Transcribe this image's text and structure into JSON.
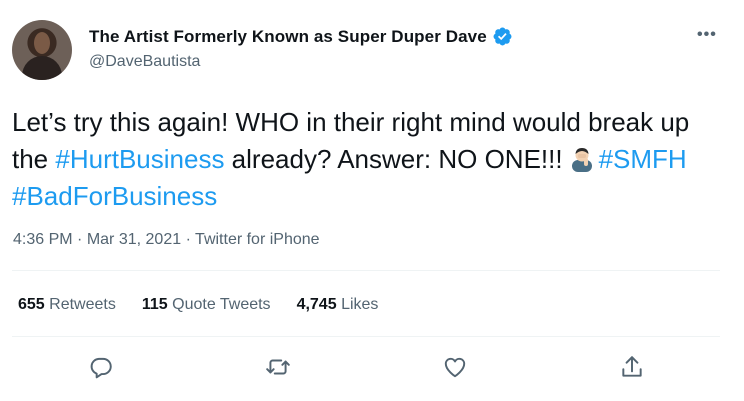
{
  "author": {
    "display_name": "The Artist Formerly Known as Super Duper Dave",
    "handle": "@DaveBautista"
  },
  "tweet": {
    "text_1": "Let’s try this again! WHO in their right mind would break up the ",
    "hashtag_1": "#HurtBusiness",
    "text_2": "  already? Answer: NO ONE!!!",
    "hashtag_2": "#SMFH",
    "hashtag_3": "#BadForBusiness",
    "emoji": "man-facepalming-emoji"
  },
  "meta": {
    "time": "4:36 PM",
    "date": "Mar 31, 2021",
    "source": "Twitter for iPhone"
  },
  "stats": {
    "retweets_count": "655",
    "retweets_label": "Retweets",
    "quotes_count": "115",
    "quotes_label": "Quote Tweets",
    "likes_count": "4,745",
    "likes_label": "Likes"
  },
  "icons": {
    "more": "more-horizontal-icon",
    "reply": "reply-icon",
    "retweet": "retweet-icon",
    "like": "heart-icon",
    "share": "share-icon",
    "verified": "verified-badge-icon"
  },
  "colors": {
    "link": "#1d9bf0",
    "muted": "#536471",
    "text": "#0f1419"
  }
}
